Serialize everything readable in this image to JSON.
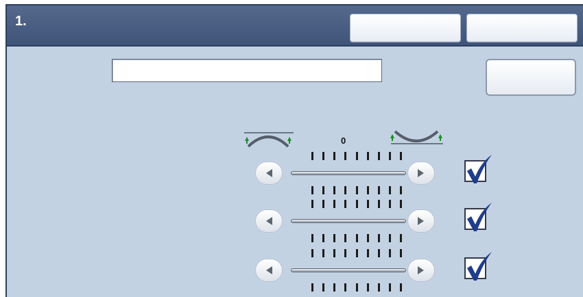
{
  "header": {
    "title": "1.",
    "button1_label": "",
    "button2_label": ""
  },
  "name_field": {
    "value": ""
  },
  "side_button": {
    "label": ""
  },
  "adjustment": {
    "current_value": "0",
    "left_icon": "curl-up-icon",
    "right_icon": "curl-down-icon",
    "rows": [
      {
        "checked": true
      },
      {
        "checked": true
      },
      {
        "checked": true
      }
    ]
  },
  "colors": {
    "header": "#4a5f83",
    "panel": "#c3d2e3",
    "checkmark": "#1f3d8a",
    "arrow_green": "#1e8a2c"
  }
}
